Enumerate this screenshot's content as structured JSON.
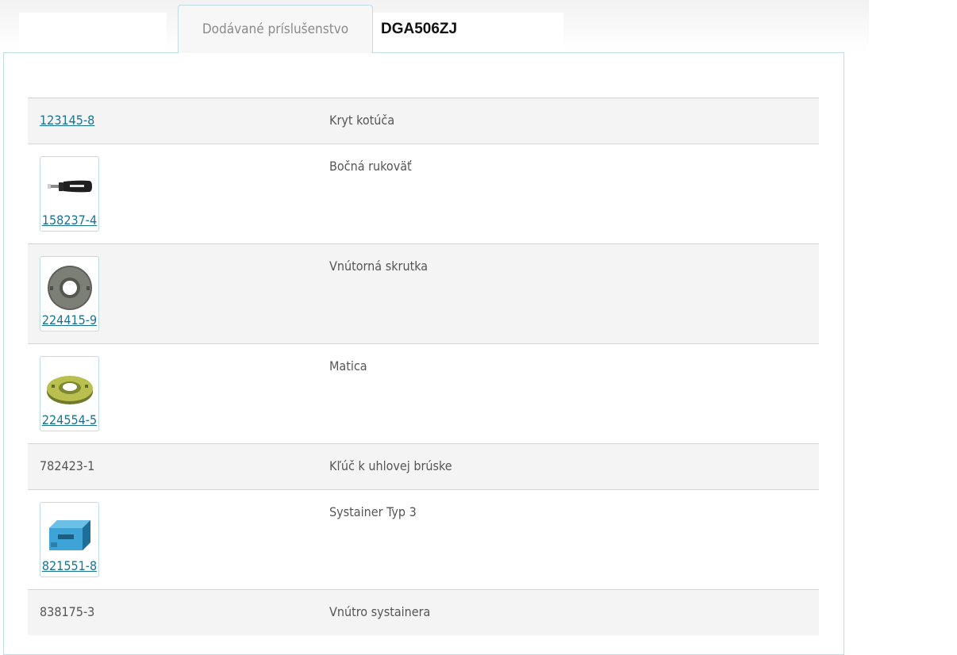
{
  "tabs": {
    "active_label": "Dodávané príslušenstvo",
    "model_name": "DGA506ZJ"
  },
  "accessories": [
    {
      "code": "123145-8",
      "description": "Kryt kotúča"
    },
    {
      "code": "158237-4",
      "description": "Bočná rukoväť",
      "icon": "side-handle-icon"
    },
    {
      "code": "224415-9",
      "description": "Vnútorná skrutka",
      "icon": "inner-flange-icon"
    },
    {
      "code": "224554-5",
      "description": "Matica",
      "icon": "lock-nut-icon"
    },
    {
      "code": "782423-1",
      "description": "Kľúč k uhlovej brúske"
    },
    {
      "code": "821551-8",
      "description": "Systainer Typ 3",
      "icon": "systainer-case-icon"
    },
    {
      "code": "838175-3",
      "description": "Vnútro systainera"
    }
  ],
  "colors": {
    "link": "#1a7392",
    "border": "#bfdde4",
    "row_shade": "#f4f4f4"
  }
}
